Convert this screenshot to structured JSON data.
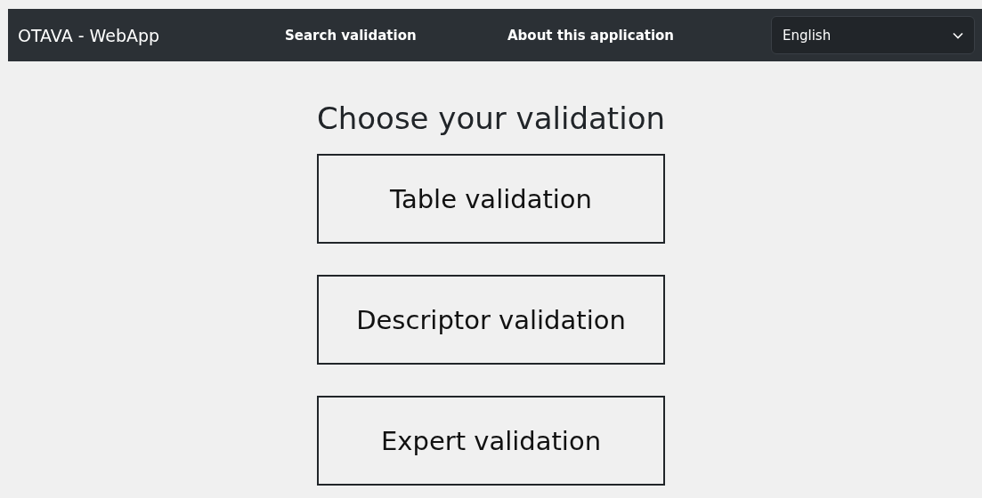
{
  "navbar": {
    "brand": "OTAVA - WebApp",
    "links": [
      "Search validation",
      "About this application"
    ],
    "language": {
      "value": "English"
    }
  },
  "heading": "Choose your validation",
  "options": [
    "Table validation",
    "Descriptor validation",
    "Expert validation"
  ]
}
